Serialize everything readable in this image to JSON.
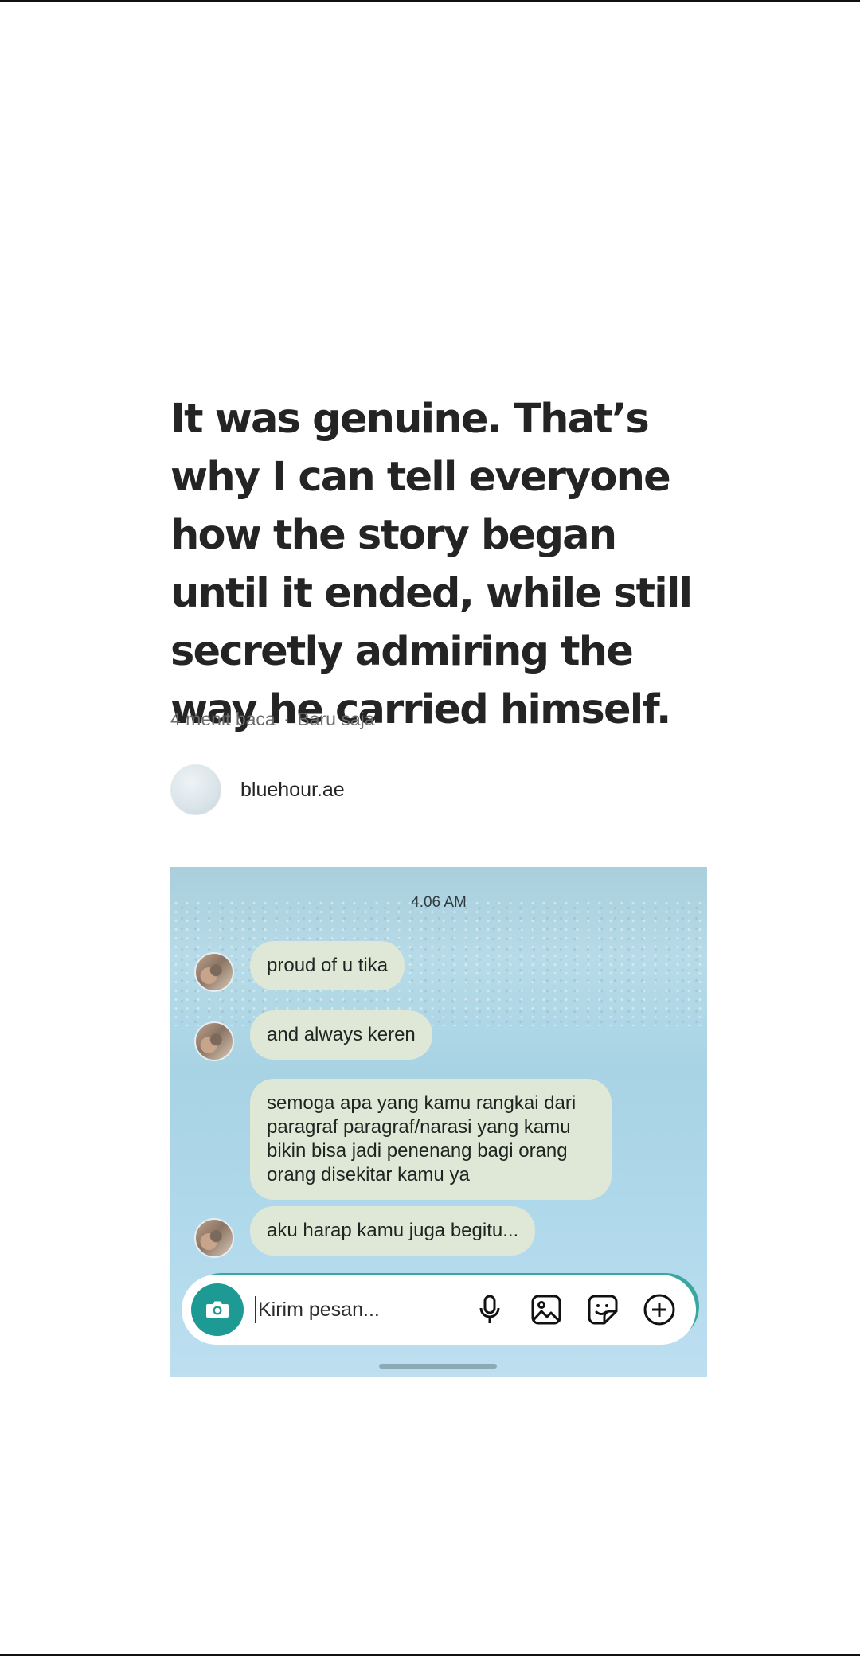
{
  "article": {
    "title": "It was genuine. That’s why I can tell everyone how the story began until it ended, while still secretly admiring the way he carried himself.",
    "read_time": "4 menit baca",
    "separator": "·",
    "published": "Baru saja",
    "author": "bluehour.ae"
  },
  "chat": {
    "timestamp": "4.06 AM",
    "messages": [
      {
        "text": "proud of u tika",
        "has_avatar": true
      },
      {
        "text": "and always keren",
        "has_avatar": true
      },
      {
        "text": "semoga apa yang kamu rangkai dari paragraf paragraf/narasi yang kamu bikin bisa jadi penenang bagi orang orang disekitar kamu ya",
        "has_avatar": false
      },
      {
        "text": "aku harap kamu juga begitu...",
        "has_avatar": true
      }
    ],
    "composer": {
      "placeholder": "Kirim pesan...",
      "icons": [
        "camera-icon",
        "microphone-icon",
        "gallery-icon",
        "sticker-icon",
        "add-icon"
      ]
    },
    "colors": {
      "bubble": "#dfe7d6",
      "camera_button": "#1d9a93",
      "background": "#b0d9eb"
    }
  }
}
